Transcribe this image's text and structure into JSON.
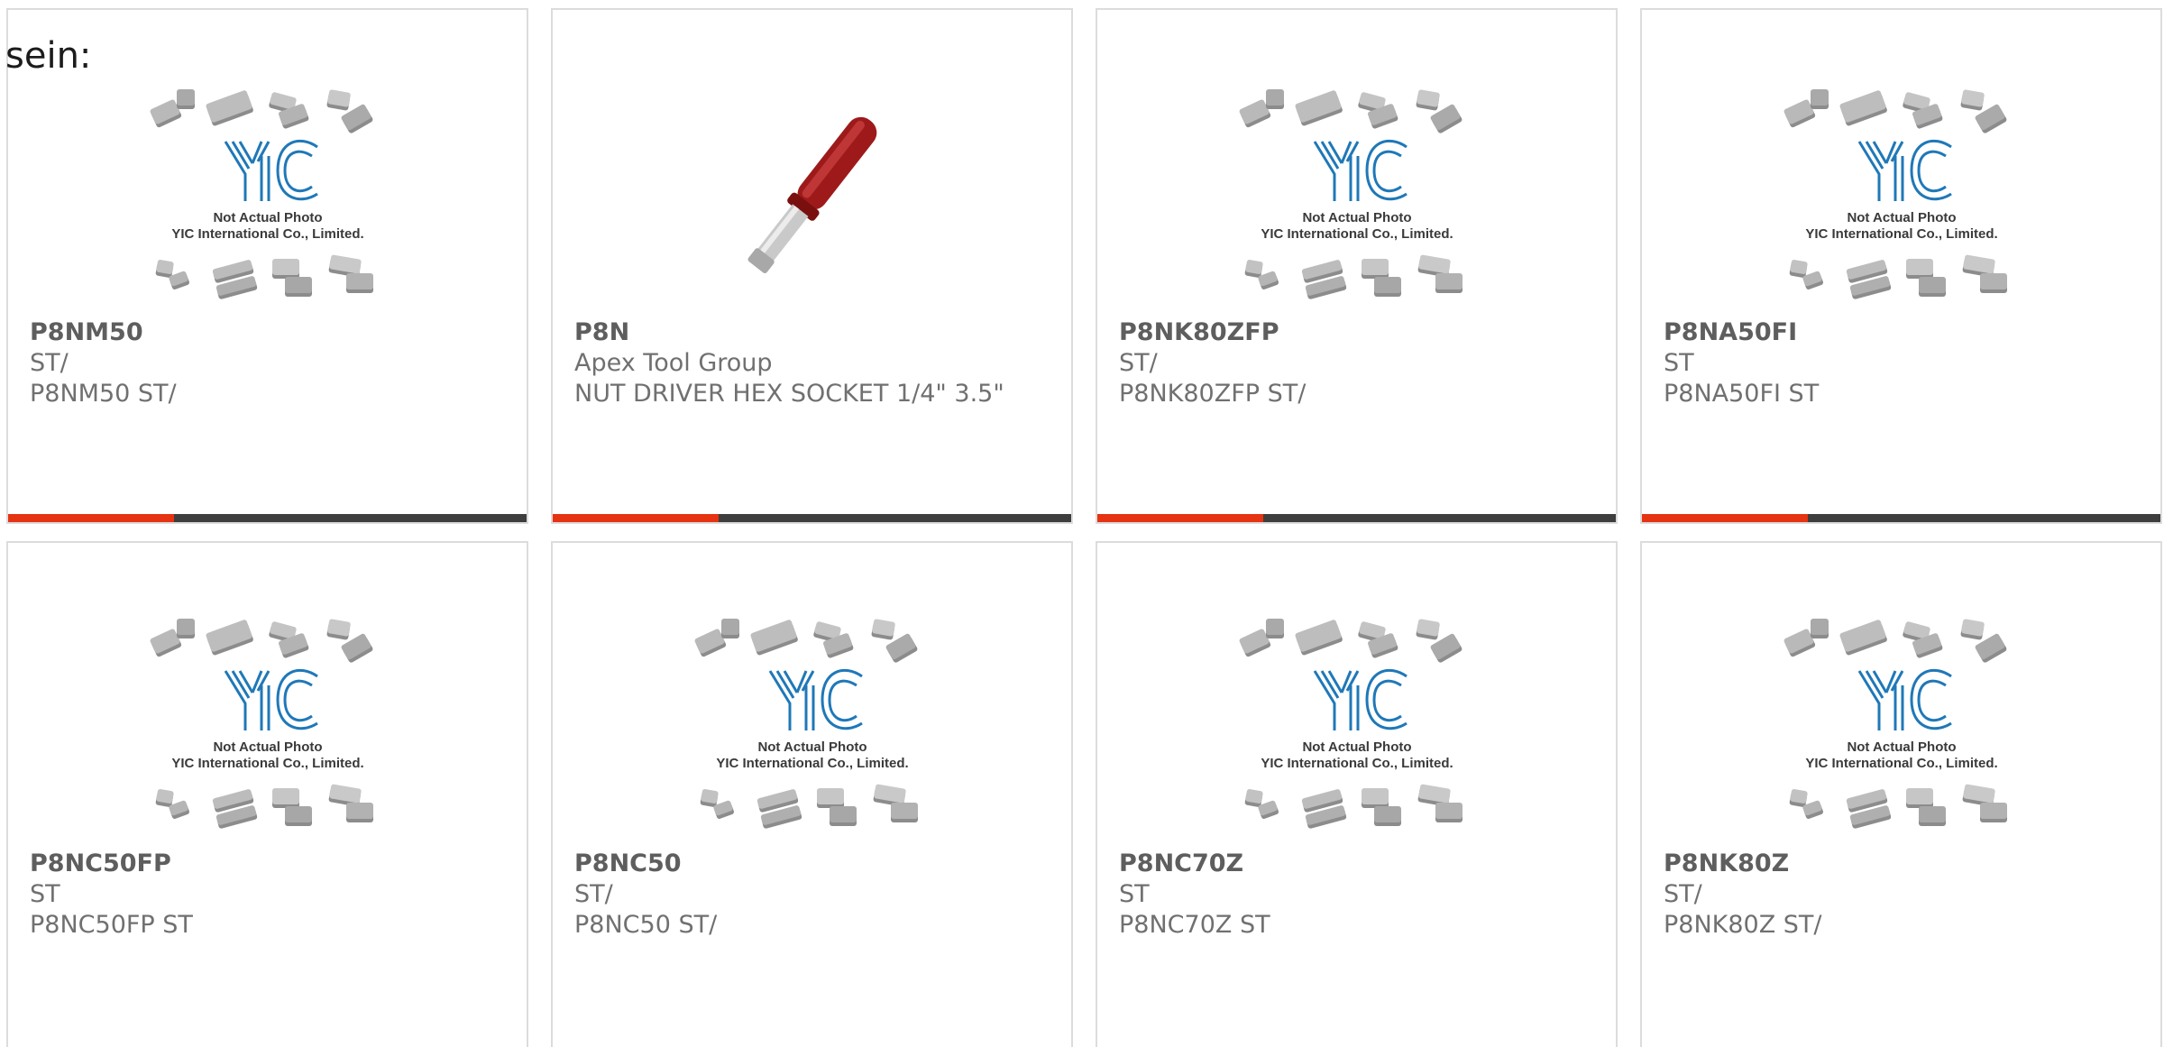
{
  "intro_text": "sein:",
  "colors": {
    "accent": "#e63312",
    "bar_track": "#3e3e3e",
    "logo_blue": "#1f78b8",
    "card_border": "#dcdcdc",
    "text_gray": "#707070"
  },
  "placeholder": {
    "caption_line1": "Not Actual Photo",
    "caption_line2": "YIC International Co., Limited.",
    "logo_text": "YIC"
  },
  "products": [
    {
      "part": "P8NM50",
      "maker": "ST/",
      "desc": "P8NM50 ST/",
      "image": "yic-placeholder",
      "progress": 0.32
    },
    {
      "part": "P8N",
      "maker": "Apex Tool Group",
      "desc": "NUT DRIVER HEX SOCKET 1/4\" 3.5\"",
      "image": "nut-driver-photo",
      "progress": 0.32
    },
    {
      "part": "P8NK80ZFP",
      "maker": "ST/",
      "desc": "P8NK80ZFP ST/",
      "image": "yic-placeholder",
      "progress": 0.32
    },
    {
      "part": "P8NA50FI",
      "maker": "ST",
      "desc": "P8NA50FI ST",
      "image": "yic-placeholder",
      "progress": 0.32
    },
    {
      "part": "P8NC50FP",
      "maker": "ST",
      "desc": "P8NC50FP ST",
      "image": "yic-placeholder"
    },
    {
      "part": "P8NC50",
      "maker": "ST/",
      "desc": "P8NC50 ST/",
      "image": "yic-placeholder"
    },
    {
      "part": "P8NC70Z",
      "maker": "ST",
      "desc": "P8NC70Z ST",
      "image": "yic-placeholder"
    },
    {
      "part": "P8NK80Z",
      "maker": "ST/",
      "desc": "P8NK80Z ST/",
      "image": "yic-placeholder"
    }
  ]
}
